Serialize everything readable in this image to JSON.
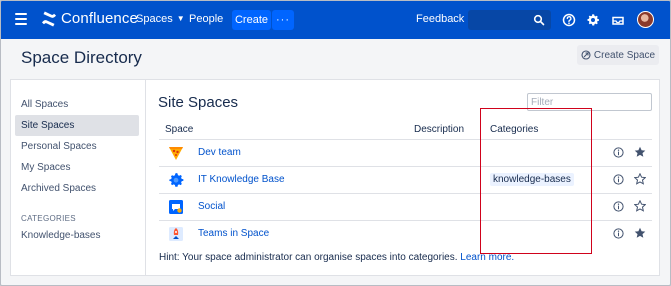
{
  "topnav": {
    "logo_text": "Confluence",
    "spaces_label": "Spaces",
    "people_label": "People",
    "create_label": "Create",
    "more_label": "···",
    "feedback_label": "Feedback",
    "icons": [
      "menu-icon",
      "confluence-logo-icon",
      "search-icon",
      "help-icon",
      "settings-icon",
      "notifications-icon",
      "avatar"
    ]
  },
  "header": {
    "title": "Space Directory",
    "create_space_label": "Create Space"
  },
  "sidebar": {
    "items": [
      {
        "label": "All Spaces",
        "active": false
      },
      {
        "label": "Site Spaces",
        "active": true
      },
      {
        "label": "Personal Spaces",
        "active": false
      },
      {
        "label": "My Spaces",
        "active": false
      },
      {
        "label": "Archived Spaces",
        "active": false
      }
    ],
    "categories_title": "CATEGORIES",
    "categories": [
      {
        "label": "Knowledge-bases"
      }
    ]
  },
  "main": {
    "title": "Site Spaces",
    "filter_placeholder": "Filter",
    "columns": {
      "space": "Space",
      "description": "Description",
      "categories": "Categories"
    },
    "rows": [
      {
        "name": "Dev team",
        "category": "",
        "favourite": true,
        "icon": "pizza-icon"
      },
      {
        "name": "IT Knowledge Base",
        "category": "knowledge-bases",
        "favourite": false,
        "icon": "gear-icon"
      },
      {
        "name": "Social",
        "category": "",
        "favourite": false,
        "icon": "chat-icon"
      },
      {
        "name": "Teams in Space",
        "category": "",
        "favourite": true,
        "icon": "rocket-icon"
      }
    ],
    "hint_text": "Hint: Your space administrator can organise spaces into categories.",
    "hint_link": "Learn more."
  },
  "colors": {
    "nav_bg": "#0052cc",
    "link": "#0052cc",
    "highlight_box": "#d0021b"
  }
}
